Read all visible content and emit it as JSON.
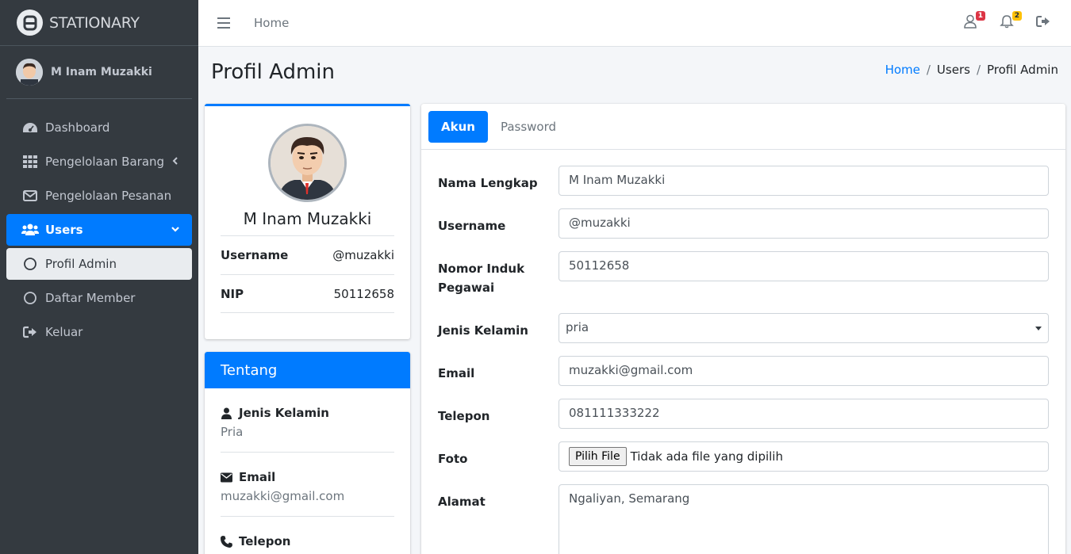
{
  "brand": {
    "name": "STATIONARY"
  },
  "sidebar": {
    "user_name": "M Inam Muzakki",
    "items": [
      {
        "label": "Dashboard",
        "icon": "dashboard-icon"
      },
      {
        "label": "Pengelolaan Barang",
        "icon": "grid-icon"
      },
      {
        "label": "Pengelolaan Pesanan",
        "icon": "envelope-icon"
      },
      {
        "label": "Users",
        "icon": "users-icon"
      },
      {
        "label": "Profil Admin",
        "icon": "circle-icon"
      },
      {
        "label": "Daftar Member",
        "icon": "circle-icon"
      },
      {
        "label": "Keluar",
        "icon": "sign-out-icon"
      }
    ]
  },
  "topbar": {
    "home_label": "Home",
    "user_badge": "1",
    "bell_badge": "2"
  },
  "header": {
    "title": "Profil Admin",
    "breadcrumb": [
      "Home",
      "Users",
      "Profil Admin"
    ]
  },
  "profile": {
    "name": "M Inam Muzakki",
    "rows": [
      {
        "label": "Username",
        "value": "@muzakki"
      },
      {
        "label": "NIP",
        "value": "50112658"
      }
    ]
  },
  "about": {
    "title": "Tentang",
    "items": [
      {
        "label": "Jenis Kelamin",
        "value": "Pria"
      },
      {
        "label": "Email",
        "value": "muzakki@gmail.com"
      },
      {
        "label": "Telepon",
        "value": ""
      }
    ]
  },
  "form": {
    "tabs": [
      "Akun",
      "Password"
    ],
    "fields": {
      "nama": {
        "label": "Nama Lengkap",
        "value": "M Inam Muzakki"
      },
      "username": {
        "label": "Username",
        "value": "@muzakki"
      },
      "nip": {
        "label": "Nomor Induk Pegawai",
        "value": "50112658"
      },
      "gender": {
        "label": "Jenis Kelamin",
        "value": "pria"
      },
      "email": {
        "label": "Email",
        "value": "muzakki@gmail.com"
      },
      "telepon": {
        "label": "Telepon",
        "value": "081111333222"
      },
      "foto": {
        "label": "Foto",
        "button": "Pilih File",
        "status": "Tidak ada file yang dipilih"
      },
      "alamat": {
        "label": "Alamat",
        "value": "Ngaliyan, Semarang"
      }
    }
  },
  "colors": {
    "primary": "#007bff",
    "sidebar": "#343a40",
    "danger": "#dc3545",
    "warning": "#ffc107"
  }
}
